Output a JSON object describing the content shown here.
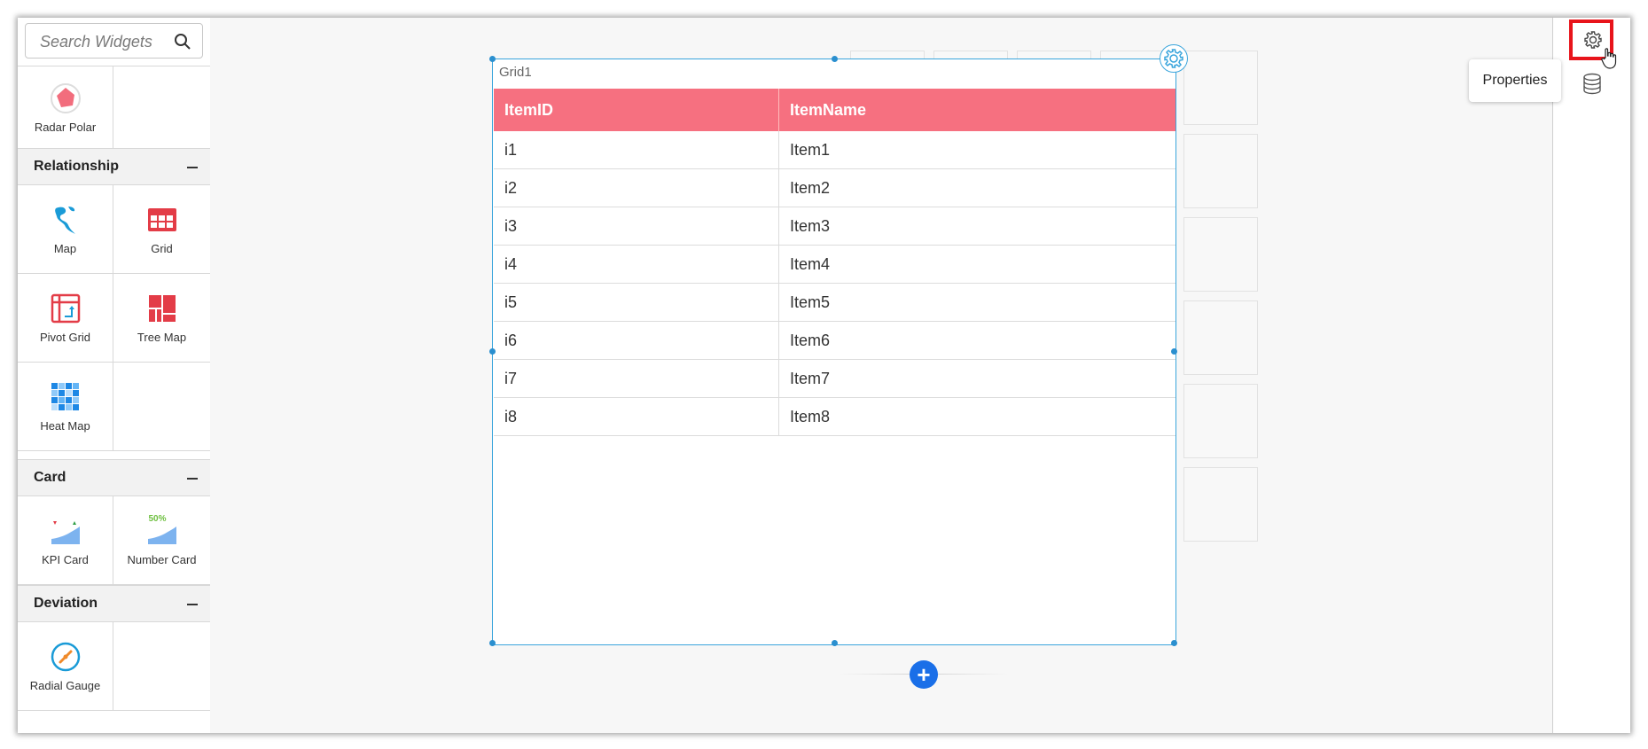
{
  "sidebar": {
    "search_placeholder": "Search Widgets",
    "top_widgets": [
      {
        "label": "Radar Polar",
        "icon": "radar-polar-icon"
      },
      {
        "label": "",
        "icon": ""
      }
    ],
    "sections": [
      {
        "title": "Relationship",
        "widgets": [
          {
            "label": "Map",
            "icon": "map-icon"
          },
          {
            "label": "Grid",
            "icon": "grid-icon"
          },
          {
            "label": "Pivot Grid",
            "icon": "pivot-grid-icon"
          },
          {
            "label": "Tree Map",
            "icon": "tree-map-icon"
          },
          {
            "label": "Heat Map",
            "icon": "heat-map-icon"
          }
        ]
      },
      {
        "title": "Card",
        "widgets": [
          {
            "label": "KPI Card",
            "icon": "kpi-card-icon"
          },
          {
            "label": "Number Card",
            "icon": "number-card-icon",
            "badge": "50%"
          }
        ]
      },
      {
        "title": "Deviation",
        "widgets": [
          {
            "label": "Radial Gauge",
            "icon": "radial-gauge-icon"
          }
        ]
      }
    ]
  },
  "widget": {
    "title": "Grid1",
    "columns": [
      "ItemID",
      "ItemName"
    ],
    "rows": [
      [
        "i1",
        "Item1"
      ],
      [
        "i2",
        "Item2"
      ],
      [
        "i3",
        "Item3"
      ],
      [
        "i4",
        "Item4"
      ],
      [
        "i5",
        "Item5"
      ],
      [
        "i6",
        "Item6"
      ],
      [
        "i7",
        "Item7"
      ],
      [
        "i8",
        "Item8"
      ]
    ],
    "header_color": "#f67080"
  },
  "right_panel": {
    "tooltip": "Properties",
    "buttons": [
      {
        "icon": "gear-icon",
        "highlighted": true,
        "highlight_color": "#e8141b"
      },
      {
        "icon": "database-icon"
      }
    ]
  },
  "canvas": {
    "add_button_label": "+"
  }
}
